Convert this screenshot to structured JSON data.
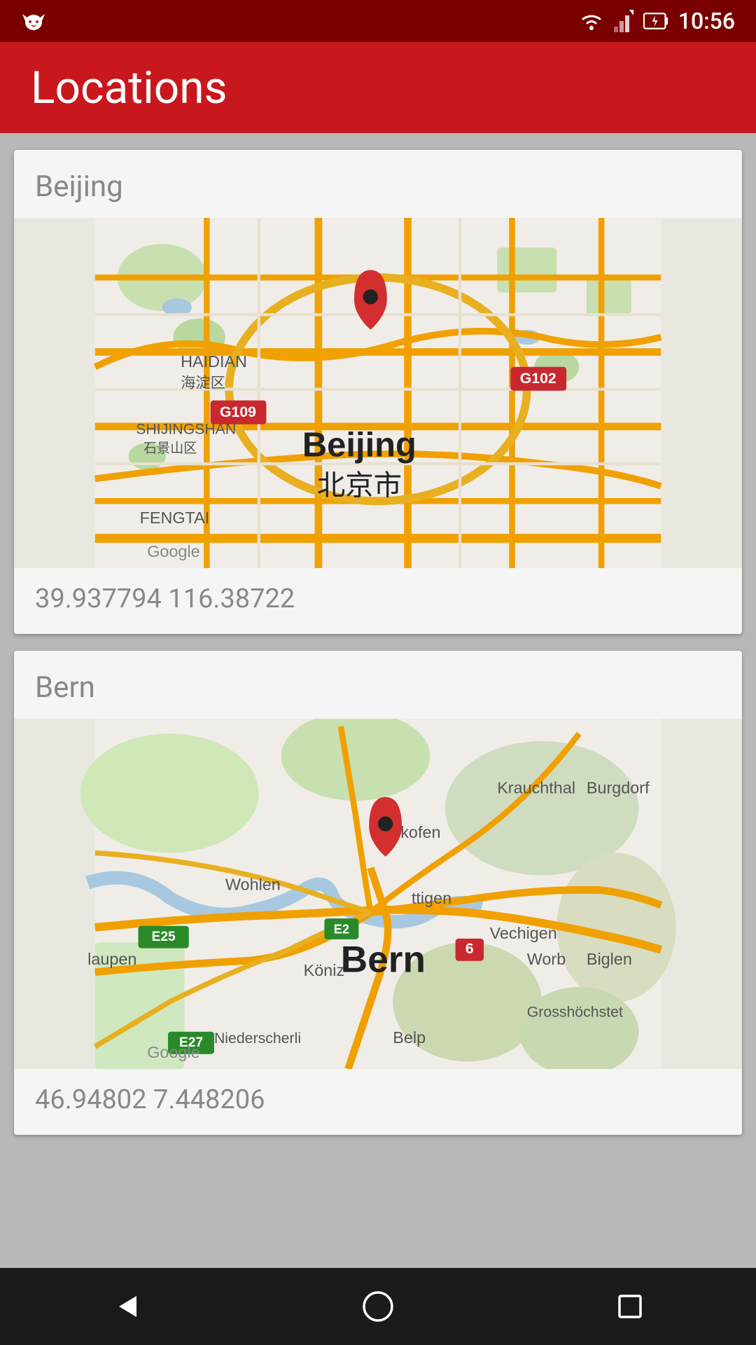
{
  "status_bar": {
    "time": "10:56",
    "cat_icon": "🐱"
  },
  "app_bar": {
    "title": "Locations"
  },
  "locations": [
    {
      "name": "Beijing",
      "coords": "39.937794 116.38722",
      "pin_x": "49%",
      "pin_y": "42%"
    },
    {
      "name": "Bern",
      "coords": "46.94802 7.448206",
      "pin_x": "38%",
      "pin_y": "40%"
    }
  ],
  "nav": {
    "back_label": "back",
    "home_label": "home",
    "recents_label": "recents"
  }
}
